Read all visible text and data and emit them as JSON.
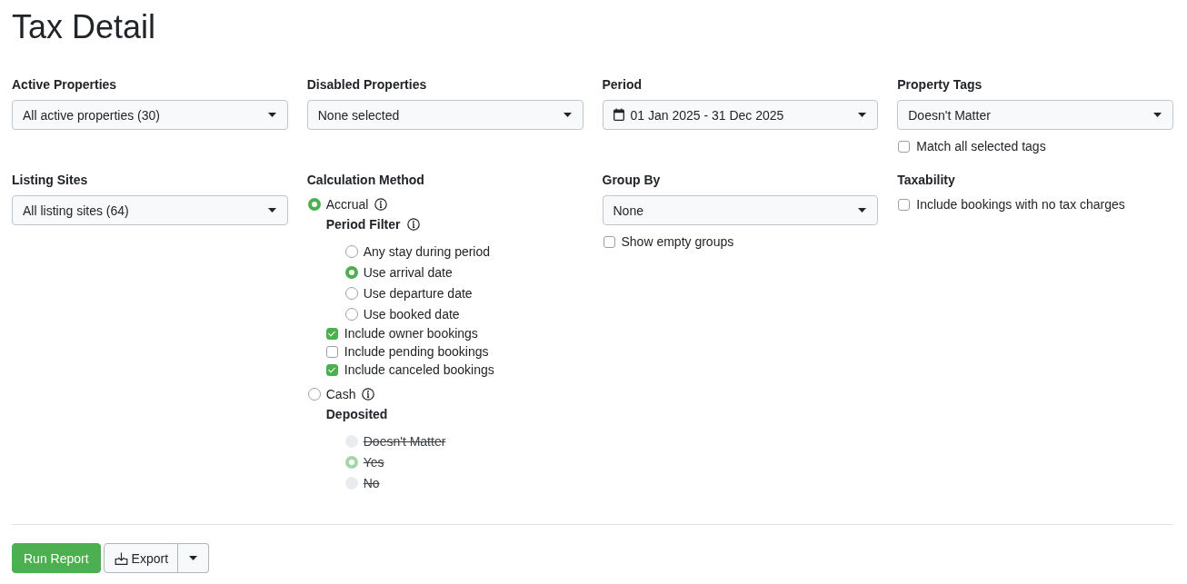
{
  "title": "Tax Detail",
  "filters": [
    {
      "kind": "select",
      "label": "Active Properties",
      "value": "All active properties (30)"
    },
    {
      "kind": "select",
      "label": "Disabled Properties",
      "value": "None selected"
    },
    {
      "kind": "date_range",
      "label": "Period",
      "value": "01 Jan 2025 - 31 Dec 2025"
    },
    {
      "kind": "select",
      "label": "Property Tags",
      "value": "Doesn't Matter",
      "checkbox": {
        "label": "Match all selected tags",
        "checked": false
      }
    },
    {
      "kind": "select",
      "label": "Listing Sites",
      "value": "All listing sites (64)"
    },
    {
      "kind": "calculation",
      "label": "Calculation Method",
      "methods": [
        {
          "label": "Accrual",
          "selected": true,
          "sub_label": "Period Filter",
          "sub_label_info": true,
          "options": [
            {
              "label": "Any stay during period",
              "selected": false,
              "disabled": false
            },
            {
              "label": "Use arrival date",
              "selected": true,
              "disabled": false
            },
            {
              "label": "Use departure date",
              "selected": false,
              "disabled": false
            },
            {
              "label": "Use booked date",
              "selected": false,
              "disabled": false
            }
          ],
          "checkboxes": [
            {
              "label": "Include owner bookings",
              "checked": true
            },
            {
              "label": "Include pending bookings",
              "checked": false
            },
            {
              "label": "Include canceled bookings",
              "checked": true
            }
          ]
        },
        {
          "label": "Cash",
          "selected": false,
          "sub_label": "Deposited",
          "sub_label_info": false,
          "options": [
            {
              "label": "Doesn't Matter",
              "selected": false,
              "disabled": true
            },
            {
              "label": "Yes",
              "selected": true,
              "disabled": true
            },
            {
              "label": "No",
              "selected": false,
              "disabled": true
            }
          ]
        }
      ]
    },
    {
      "kind": "select",
      "label": "Group By",
      "value": "None",
      "checkbox": {
        "label": "Show empty groups",
        "checked": false
      }
    },
    {
      "kind": "checkbox",
      "label": "Taxability",
      "checkbox": {
        "label": "Include bookings with no tax charges",
        "checked": false
      }
    }
  ],
  "actions": [
    {
      "kind": "primary",
      "label": "Run Report"
    },
    {
      "kind": "split",
      "label": "Export"
    }
  ]
}
